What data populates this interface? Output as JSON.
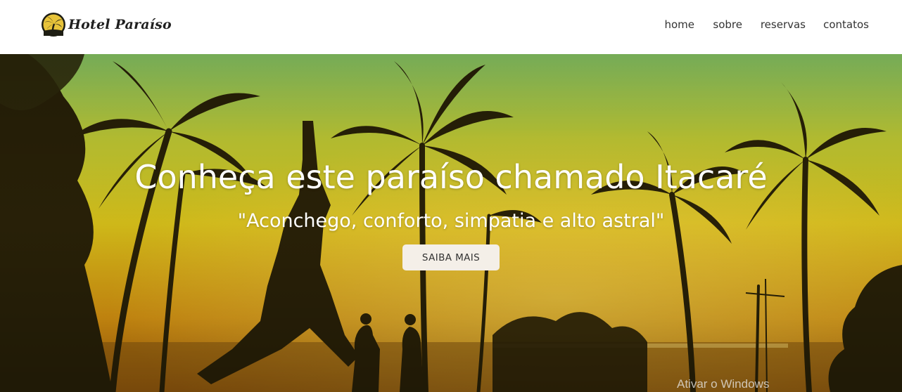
{
  "header": {
    "logo_text": "Hotel Paraíso",
    "nav": [
      {
        "label": "home"
      },
      {
        "label": "sobre"
      },
      {
        "label": "reservas"
      },
      {
        "label": "contatos"
      }
    ]
  },
  "hero": {
    "title": "Conheça este paraíso chamado Itacaré",
    "subtitle": "\"Aconchego, conforto, simpatia e alto astral\"",
    "button_label": "SAIBA MAIS",
    "background_image": "sunset-beach-palm-trees",
    "colors": {
      "sky_top": "#8fd16a",
      "sky_mid": "#d9c21a",
      "sky_low": "#e39b12",
      "silhouette": "#2a2208"
    }
  },
  "os_overlay": {
    "watermark": "Ativar o Windows"
  }
}
